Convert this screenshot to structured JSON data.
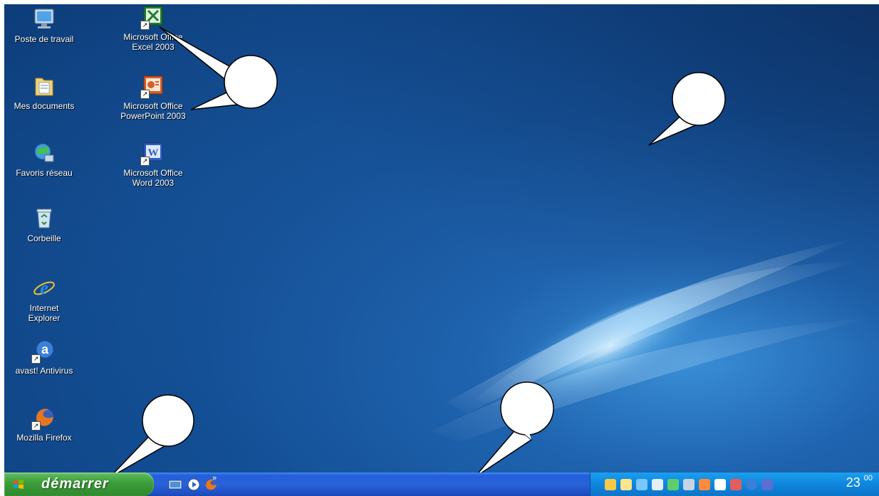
{
  "desktop": {
    "icons": [
      {
        "label_line1": "Poste de travail",
        "label_line2": "",
        "icon": "computer-icon"
      },
      {
        "label_line1": "Microsoft Office",
        "label_line2": "Excel 2003",
        "icon": "excel-icon"
      },
      {
        "label_line1": "Mes documents",
        "label_line2": "",
        "icon": "folder-icon"
      },
      {
        "label_line1": "Microsoft Office",
        "label_line2": "PowerPoint 2003",
        "icon": "powerpoint-icon"
      },
      {
        "label_line1": "Favoris réseau",
        "label_line2": "",
        "icon": "network-icon"
      },
      {
        "label_line1": "Microsoft Office",
        "label_line2": "Word 2003",
        "icon": "word-icon"
      },
      {
        "label_line1": "Corbeille",
        "label_line2": "",
        "icon": "recycle-bin-icon"
      },
      {
        "label_line1": "Internet",
        "label_line2": "Explorer",
        "icon": "internet-explorer-icon"
      },
      {
        "label_line1": "avast! Antivirus",
        "label_line2": "",
        "icon": "avast-icon"
      },
      {
        "label_line1": "Mozilla Firefox",
        "label_line2": "",
        "icon": "firefox-icon"
      }
    ]
  },
  "taskbar": {
    "start_label": "démarrer",
    "chevron": "»",
    "clock_hour": "23",
    "clock_minute": "00"
  },
  "colors": {
    "desktop_blue": "#134f95",
    "taskbar_blue": "#245edc",
    "start_green": "#3c9c3a",
    "tray_blue": "#0f86dd"
  }
}
